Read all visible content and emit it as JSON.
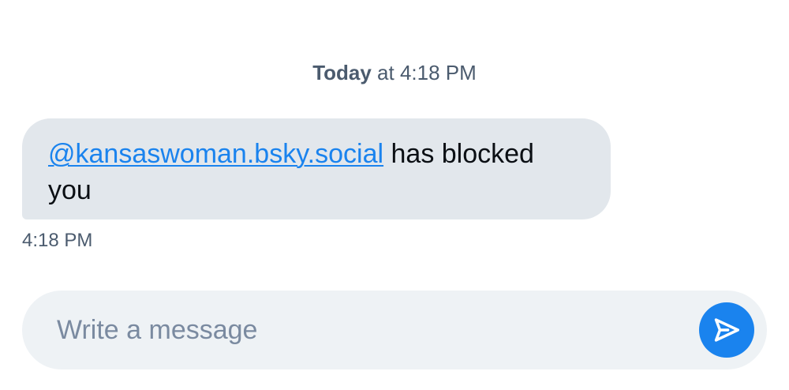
{
  "conversation": {
    "date_divider": {
      "day": "Today",
      "rest": " at 4:18 PM"
    },
    "messages": [
      {
        "mention": "@kansaswoman.bsky.social",
        "text": " has blocked you",
        "time": "4:18 PM"
      }
    ]
  },
  "composer": {
    "placeholder": "Write a message",
    "value": "",
    "send_icon": "paper-plane-icon"
  },
  "colors": {
    "accent": "#1a83ee",
    "bubble_background": "#e2e7ec",
    "composer_background": "#eef2f5",
    "muted_text": "#4b5b6e",
    "placeholder": "#7a8aa0"
  }
}
